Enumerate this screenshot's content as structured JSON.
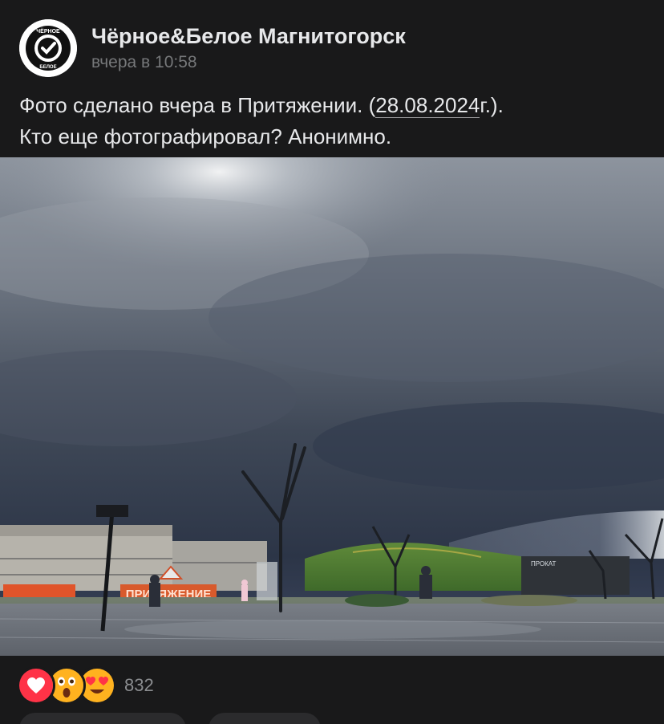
{
  "post": {
    "author": "Чёрное&Белое Магнитогорск",
    "time": "вчера в 10:58",
    "text_part1": "Фото сделано вчера в Притяжении. (",
    "date_link": "28.08.2024",
    "text_part2": "г.).",
    "text_line2": "Кто еще фотографировал? Анонимно."
  },
  "avatar": {
    "logo_text_top": "ЧЁРНОЕ",
    "logo_text_bottom": "БЕЛОЕ"
  },
  "photo": {
    "sign_text": "ПРИТЯЖЕНИЕ",
    "booth_text": "ПРОКАТ"
  },
  "reactions": {
    "count": "832",
    "icons": [
      "heart-icon",
      "surprised-face-icon",
      "heart-eyes-face-icon"
    ],
    "colors": {
      "heart": "#ff3347",
      "face": "#ffb21f"
    }
  },
  "colors": {
    "background": "#19191a",
    "text": "#e7e8ea",
    "muted": "#76787a"
  }
}
